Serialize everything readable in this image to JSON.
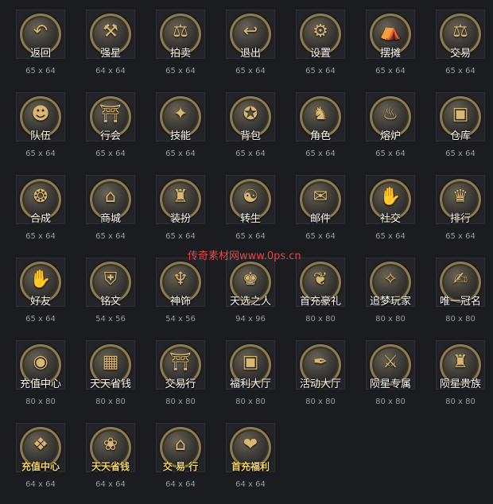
{
  "watermark": "传奇素材网www.0ps.cn",
  "icons": [
    {
      "label": "返回",
      "size": "65 x 64",
      "icon": "back-arrow-icon",
      "glyph": "↶",
      "gold": false
    },
    {
      "label": "强星",
      "size": "64 x 64",
      "icon": "hammer-icon",
      "glyph": "⚒",
      "gold": false
    },
    {
      "label": "拍卖",
      "size": "65 x 64",
      "icon": "gavel-icon",
      "glyph": "⚖",
      "gold": false
    },
    {
      "label": "退出",
      "size": "65 x 64",
      "icon": "exit-arrow-icon",
      "glyph": "↩",
      "gold": false
    },
    {
      "label": "设置",
      "size": "65 x 64",
      "icon": "gear-icon",
      "glyph": "⚙",
      "gold": false
    },
    {
      "label": "摆摊",
      "size": "65 x 64",
      "icon": "stall-icon",
      "glyph": "⛺",
      "gold": false
    },
    {
      "label": "交易",
      "size": "65 x 64",
      "icon": "scales-icon",
      "glyph": "⚖",
      "gold": false
    },
    {
      "label": "队伍",
      "size": "65 x 64",
      "icon": "team-icon",
      "glyph": "☻",
      "gold": false
    },
    {
      "label": "行会",
      "size": "65 x 64",
      "icon": "guild-gate-icon",
      "glyph": "⛩",
      "gold": false
    },
    {
      "label": "技能",
      "size": "65 x 64",
      "icon": "skill-scroll-icon",
      "glyph": "✦",
      "gold": false
    },
    {
      "label": "背包",
      "size": "65 x 64",
      "icon": "backpack-icon",
      "glyph": "✪",
      "gold": false
    },
    {
      "label": "角色",
      "size": "65 x 64",
      "icon": "helmet-icon",
      "glyph": "♞",
      "gold": false
    },
    {
      "label": "熔炉",
      "size": "65 x 64",
      "icon": "furnace-icon",
      "glyph": "♨",
      "gold": false
    },
    {
      "label": "仓库",
      "size": "65 x 64",
      "icon": "chest-icon",
      "glyph": "▣",
      "gold": false
    },
    {
      "label": "合成",
      "size": "65 x 64",
      "icon": "cauldron-icon",
      "glyph": "❂",
      "gold": false
    },
    {
      "label": "商城",
      "size": "65 x 64",
      "icon": "shop-icon",
      "glyph": "⌂",
      "gold": false
    },
    {
      "label": "装扮",
      "size": "65 x 64",
      "icon": "armor-icon",
      "glyph": "♜",
      "gold": false
    },
    {
      "label": "转生",
      "size": "65 x 64",
      "icon": "rebirth-icon",
      "glyph": "☯",
      "gold": false
    },
    {
      "label": "邮件",
      "size": "65 x 64",
      "icon": "mail-icon",
      "glyph": "✉",
      "gold": false
    },
    {
      "label": "社交",
      "size": "65 x 64",
      "icon": "handshake-icon",
      "glyph": "✋",
      "gold": false
    },
    {
      "label": "排行",
      "size": "65 x 64",
      "icon": "ranking-icon",
      "glyph": "♛",
      "gold": false
    },
    {
      "label": "好友",
      "size": "65 x 64",
      "icon": "friend-handshake-icon",
      "glyph": "✋",
      "gold": false
    },
    {
      "label": "铭文",
      "size": "54 x 56",
      "icon": "inscription-icon",
      "glyph": "⛨",
      "gold": false
    },
    {
      "label": "神饰",
      "size": "54 x 56",
      "icon": "ornament-icon",
      "glyph": "♆",
      "gold": false
    },
    {
      "label": "天选之人",
      "size": "94 x 96",
      "icon": "chosen-hero-icon",
      "glyph": "♚",
      "gold": false
    },
    {
      "label": "首充豪礼",
      "size": "80 x 80",
      "icon": "first-recharge-gift-icon",
      "glyph": "❦",
      "gold": false
    },
    {
      "label": "追梦玩家",
      "size": "80 x 80",
      "icon": "dream-player-icon",
      "glyph": "✧",
      "gold": false
    },
    {
      "label": "唯一冠名",
      "size": "80 x 80",
      "icon": "title-scroll-icon",
      "glyph": "✍",
      "gold": false
    },
    {
      "label": "充值中心",
      "size": "80 x 80",
      "icon": "gold-ingot-icon",
      "glyph": "◉",
      "gold": false
    },
    {
      "label": "天天省钱",
      "size": "80 x 80",
      "icon": "gift-box-icon",
      "glyph": "▦",
      "gold": false
    },
    {
      "label": "交易行",
      "size": "80 x 80",
      "icon": "pavilion-icon",
      "glyph": "⛩",
      "gold": false
    },
    {
      "label": "福利大厅",
      "size": "80 x 80",
      "icon": "treasure-chest-icon",
      "glyph": "▣",
      "gold": false
    },
    {
      "label": "活动大厅",
      "size": "80 x 80",
      "icon": "quill-scroll-icon",
      "glyph": "✒",
      "gold": false
    },
    {
      "label": "陨星专属",
      "size": "80 x 80",
      "icon": "meteor-sword-icon",
      "glyph": "⚔",
      "gold": false
    },
    {
      "label": "陨星贵族",
      "size": "80 x 80",
      "icon": "dragon-icon",
      "glyph": "♜",
      "gold": false
    },
    {
      "label": "充值中心",
      "size": "64 x 64",
      "icon": "red-chest-icon",
      "glyph": "❖",
      "gold": true
    },
    {
      "label": "天天省钱",
      "size": "64 x 64",
      "icon": "money-pot-icon",
      "glyph": "❀",
      "gold": true
    },
    {
      "label": "交 易 行",
      "size": "64 x 64",
      "icon": "trade-stall-icon",
      "glyph": "⌂",
      "gold": true
    },
    {
      "label": "首充福利",
      "size": "64 x 64",
      "icon": "pink-gift-icon",
      "glyph": "❤",
      "gold": true
    }
  ]
}
